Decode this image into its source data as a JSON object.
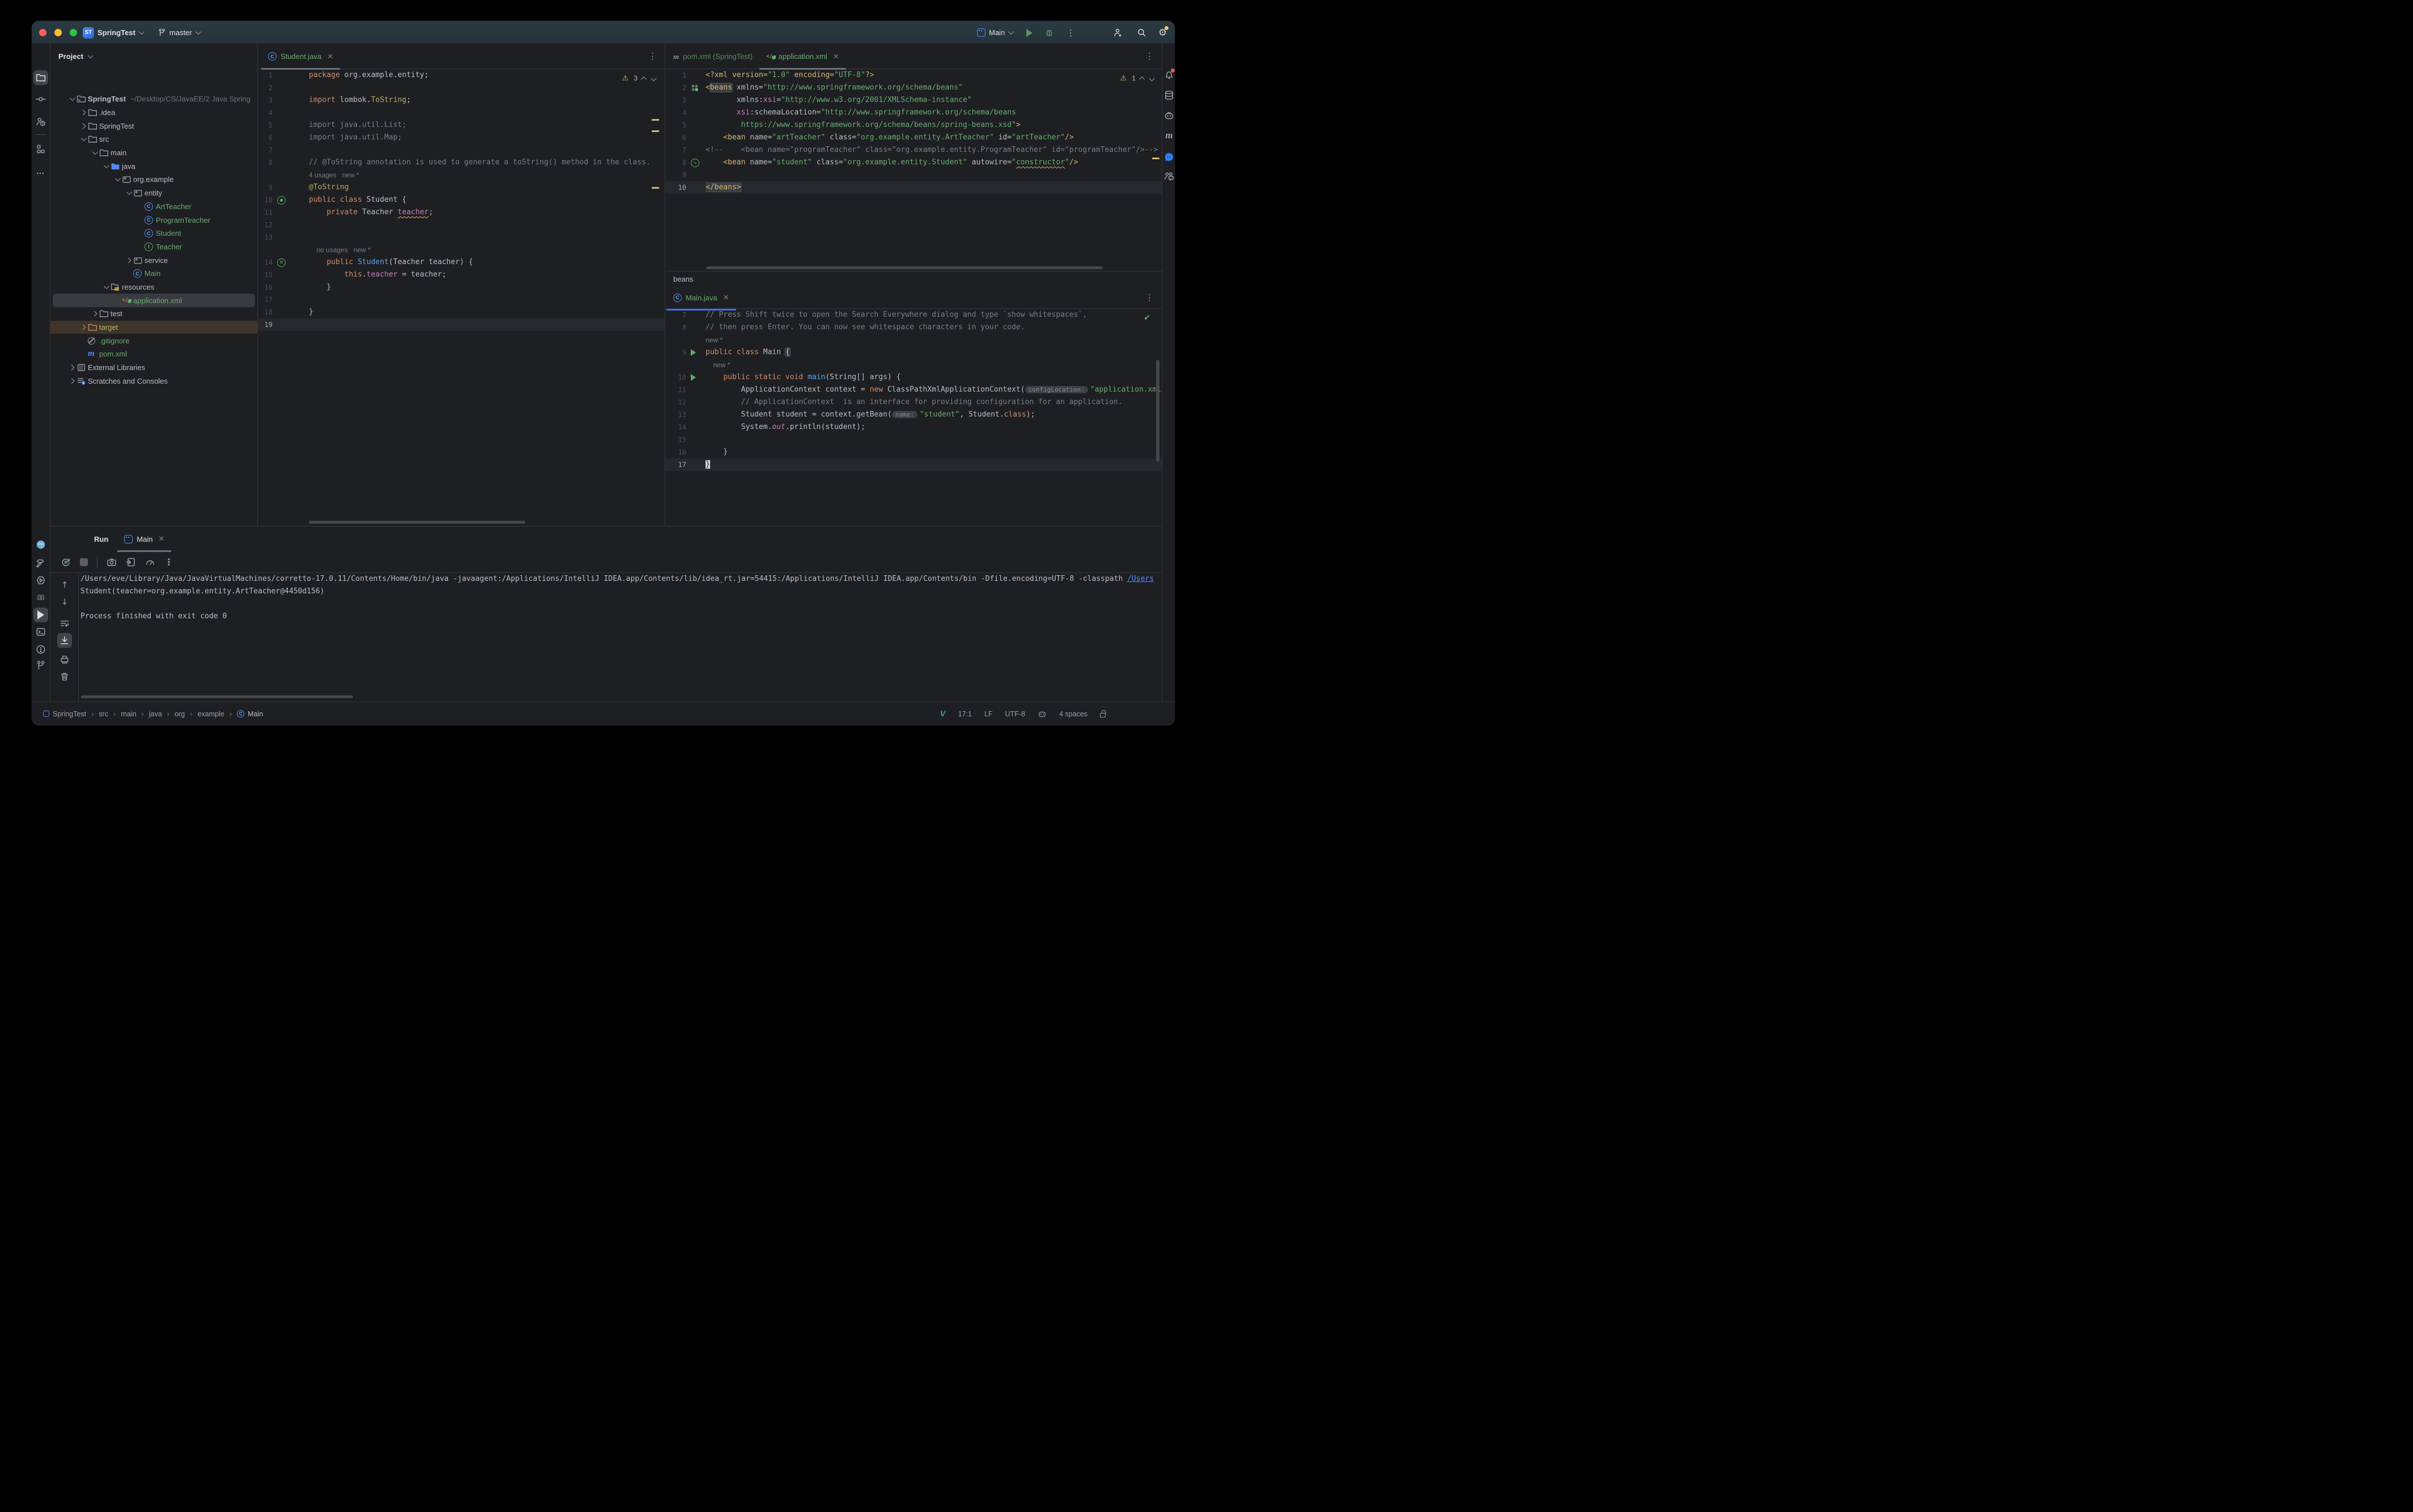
{
  "titlebar": {
    "project": "SpringTest",
    "project_badge": "ST",
    "branch": "master",
    "run_config": "Main"
  },
  "left_stripe": {
    "top": [
      {
        "icon": "project-folder",
        "active": true
      },
      {
        "icon": "commit"
      },
      {
        "icon": "pull-requests"
      },
      {
        "icon": "divider"
      },
      {
        "icon": "structure"
      },
      {
        "icon": "more"
      }
    ],
    "bottom": [
      {
        "icon": "plugin-mascot"
      },
      {
        "icon": "build-hammer"
      },
      {
        "icon": "services"
      },
      {
        "icon": "frames"
      },
      {
        "icon": "run",
        "active": true
      },
      {
        "icon": "terminal"
      },
      {
        "icon": "problems"
      },
      {
        "icon": "version-control"
      }
    ]
  },
  "right_stripe": [
    {
      "icon": "notifications",
      "badge": true
    },
    {
      "icon": "database"
    },
    {
      "icon": "copilot"
    },
    {
      "icon": "maven"
    },
    {
      "icon": "ai-assistant"
    },
    {
      "icon": "code-with-me"
    }
  ],
  "project_panel": {
    "header": "Project",
    "tree": [
      {
        "d": 0,
        "chev": "v",
        "icon": "module",
        "label": "SpringTest",
        "bold": true,
        "extra": "~/Desktop/CS/JavaEE/2 Java Spring"
      },
      {
        "d": 1,
        "chev": ">",
        "icon": "folder",
        "label": ".idea"
      },
      {
        "d": 1,
        "chev": ">",
        "icon": "folder",
        "label": "SpringTest"
      },
      {
        "d": 1,
        "chev": "v",
        "icon": "folder",
        "label": "src"
      },
      {
        "d": 2,
        "chev": "v",
        "icon": "folder",
        "label": "main"
      },
      {
        "d": 3,
        "chev": "v",
        "icon": "folder-blue",
        "label": "java"
      },
      {
        "d": 4,
        "chev": "v",
        "icon": "pkg",
        "label": "org.example"
      },
      {
        "d": 5,
        "chev": "v",
        "icon": "pkg",
        "label": "entity"
      },
      {
        "d": 6,
        "icon": "class",
        "label": "ArtTeacher",
        "color": "#6aab73"
      },
      {
        "d": 6,
        "icon": "class",
        "label": "ProgramTeacher",
        "color": "#6aab73"
      },
      {
        "d": 6,
        "icon": "class",
        "label": "Student",
        "color": "#6aab73"
      },
      {
        "d": 6,
        "icon": "iface",
        "label": "Teacher",
        "color": "#6aab73"
      },
      {
        "d": 5,
        "chev": ">",
        "icon": "pkg",
        "label": "service"
      },
      {
        "d": 5,
        "icon": "class",
        "label": "Main",
        "color": "#6aab73"
      },
      {
        "d": 3,
        "chev": "v",
        "icon": "folder-res",
        "label": "resources"
      },
      {
        "d": 4,
        "icon": "spring",
        "label": "application.xml",
        "color": "#6aab73",
        "selected": true
      },
      {
        "d": 2,
        "chev": ">",
        "icon": "folder",
        "label": "test"
      },
      {
        "d": 1,
        "chev": ">",
        "icon": "folder-target",
        "label": "target",
        "color": "#bdb76b",
        "highlight": true
      },
      {
        "d": 1,
        "icon": "ignore",
        "label": ".gitignore",
        "color": "#6aab73"
      },
      {
        "d": 1,
        "icon": "maven",
        "label": "pom.xml",
        "color": "#6aab73"
      },
      {
        "d": 0,
        "chev": ">",
        "icon": "lib",
        "label": "External Libraries"
      },
      {
        "d": 0,
        "chev": ">",
        "icon": "scratch",
        "label": "Scratches and Consoles"
      }
    ]
  },
  "editors": {
    "student": {
      "tab": "Student.java",
      "warnings": "3",
      "lines": [
        {
          "n": "1",
          "seg": [
            [
              "package ",
              "kw"
            ],
            [
              "org.example.entity;",
              "txt"
            ]
          ]
        },
        {
          "n": "2"
        },
        {
          "n": "3",
          "seg": [
            [
              "import ",
              "kw"
            ],
            [
              "lombok.",
              "txt"
            ],
            [
              "ToString",
              "ann"
            ],
            [
              ";",
              "txt"
            ]
          ]
        },
        {
          "n": "4"
        },
        {
          "n": "5",
          "seg": [
            [
              "import java.util.List;",
              "dim"
            ]
          ]
        },
        {
          "n": "6",
          "seg": [
            [
              "import java.util.Map;",
              "dim"
            ]
          ]
        },
        {
          "n": "7"
        },
        {
          "n": "8",
          "seg": [
            [
              "// @ToString annotation is used to generate a toString() method in the class.",
              "cmt"
            ]
          ]
        },
        {
          "inlay": "4 usages   new *"
        },
        {
          "n": "9",
          "seg": [
            [
              "@ToString",
              "ann"
            ]
          ]
        },
        {
          "n": "10",
          "g": "bean",
          "seg": [
            [
              "public class ",
              "kw"
            ],
            [
              "Student {",
              "txt"
            ]
          ]
        },
        {
          "n": "11",
          "seg": [
            [
              "    ",
              "txt"
            ],
            [
              "private ",
              "kw"
            ],
            [
              "Teacher ",
              "txt"
            ],
            [
              "teacher",
              "fld wavy"
            ],
            [
              ";",
              "txt"
            ]
          ]
        },
        {
          "n": "12"
        },
        {
          "n": "13"
        },
        {
          "inlay": "    no usages   new *"
        },
        {
          "n": "14",
          "g": "beanm",
          "seg": [
            [
              "    ",
              "txt"
            ],
            [
              "public ",
              "kw"
            ],
            [
              "Student",
              "mtd"
            ],
            [
              "(Teacher teacher) {",
              "txt"
            ]
          ]
        },
        {
          "n": "15",
          "seg": [
            [
              "        ",
              "txt"
            ],
            [
              "this",
              "kw"
            ],
            [
              ".",
              "txt"
            ],
            [
              "teacher",
              "fld"
            ],
            [
              " = teacher;",
              "txt"
            ]
          ]
        },
        {
          "n": "16",
          "seg": [
            [
              "    }",
              "txt"
            ]
          ]
        },
        {
          "n": "17"
        },
        {
          "n": "18",
          "seg": [
            [
              "}",
              "txt"
            ]
          ]
        },
        {
          "n": "19",
          "cur": true
        }
      ]
    },
    "xml": {
      "tab_pom": "pom.xml (SpringTest)",
      "tab_app": "application.xml",
      "warnings": "1",
      "breadcrumb": "beans",
      "lines": [
        {
          "n": "1",
          "seg": [
            [
              "<?xml ",
              "tag"
            ],
            [
              "version=",
              "tag"
            ],
            [
              "\"1.0\"",
              "str"
            ],
            [
              " encoding=",
              "tag"
            ],
            [
              "\"UTF-8\"",
              "str"
            ],
            [
              "?>",
              "tag"
            ]
          ]
        },
        {
          "n": "2",
          "g": "beangrid",
          "seg": [
            [
              "<",
              "tag"
            ],
            [
              "beans",
              "tag box"
            ],
            [
              " xmlns=",
              "attr"
            ],
            [
              "\"http://www.springframework.org/schema/beans\"",
              "str"
            ]
          ]
        },
        {
          "n": "3",
          "seg": [
            [
              "       xmlns:",
              "attr"
            ],
            [
              "xsi",
              "ns"
            ],
            [
              "=",
              "attr"
            ],
            [
              "\"http://www.w3.org/2001/XMLSchema-instance\"",
              "str"
            ]
          ]
        },
        {
          "n": "4",
          "seg": [
            [
              "       ",
              "txt"
            ],
            [
              "xsi",
              "ns"
            ],
            [
              ":schemaLocation=",
              "attr"
            ],
            [
              "\"http://www.springframework.org/schema/beans",
              "str"
            ]
          ]
        },
        {
          "n": "5",
          "seg": [
            [
              "        https://www.springframework.org/schema/beans/spring-beans.xsd\"",
              "str"
            ],
            [
              ">",
              "tag"
            ]
          ]
        },
        {
          "n": "6",
          "seg": [
            [
              "    <",
              "tag"
            ],
            [
              "bean ",
              "tag"
            ],
            [
              "name=",
              "attr"
            ],
            [
              "\"artTeacher\"",
              "str"
            ],
            [
              " class=",
              "attr"
            ],
            [
              "\"org.example.entity.ArtTeacher\"",
              "str"
            ],
            [
              " id=",
              "attr"
            ],
            [
              "\"artTeacher\"",
              "str"
            ],
            [
              "/>",
              "tag"
            ]
          ]
        },
        {
          "n": "7",
          "seg": [
            [
              "<!--    <bean name=\"programTeacher\" class=\"org.example.entity.ProgramTeacher\" id=\"programTeacher\"/>-->",
              "cmt"
            ]
          ]
        },
        {
          "n": "8",
          "g": "beanarrow",
          "seg": [
            [
              "    <",
              "tag"
            ],
            [
              "bean ",
              "tag"
            ],
            [
              "name=",
              "attr"
            ],
            [
              "\"student\"",
              "str"
            ],
            [
              " class=",
              "attr"
            ],
            [
              "\"org.example.entity.Student\"",
              "str"
            ],
            [
              " autowire=",
              "attr"
            ],
            [
              "\"",
              "str"
            ],
            [
              "constructor",
              "str wavy"
            ],
            [
              "\"",
              "str"
            ],
            [
              "/>",
              "tag"
            ]
          ]
        },
        {
          "n": "9"
        },
        {
          "n": "10",
          "cur": true,
          "seg": [
            [
              "</beans>",
              "tag box"
            ]
          ]
        }
      ]
    },
    "main": {
      "tab": "Main.java",
      "lines": [
        {
          "n": "7",
          "seg": [
            [
              "// Press Shift twice to open the Search Everywhere dialog and type `show whitespaces`,",
              "cmt"
            ]
          ]
        },
        {
          "n": "8",
          "seg": [
            [
              "// then press Enter. You can now see whitespace characters in your code.",
              "cmt"
            ]
          ]
        },
        {
          "inlay": "new *"
        },
        {
          "n": "9",
          "g": "play",
          "seg": [
            [
              "public class ",
              "kw"
            ],
            [
              "Main ",
              "txt"
            ],
            [
              "{",
              "txt box"
            ]
          ]
        },
        {
          "inlay": "    new *"
        },
        {
          "n": "10",
          "g": "play",
          "seg": [
            [
              "    ",
              "txt"
            ],
            [
              "public static void ",
              "kw"
            ],
            [
              "main",
              "mtd"
            ],
            [
              "(String[] args) {",
              "txt"
            ]
          ]
        },
        {
          "n": "11",
          "seg": [
            [
              "        ApplicationContext context = ",
              "txt"
            ],
            [
              "new ",
              "kw"
            ],
            [
              "ClassPathXmlApplicationContext(",
              "txt"
            ],
            [
              "configLocation:",
              "chip"
            ],
            [
              "\"application.xml\");",
              "str"
            ]
          ]
        },
        {
          "n": "12",
          "seg": [
            [
              "        // ApplicationContext  is an interface for providing configuration for an application.",
              "cmt"
            ]
          ]
        },
        {
          "n": "13",
          "seg": [
            [
              "        Student student = context.getBean(",
              "txt"
            ],
            [
              "name:",
              "chip"
            ],
            [
              "\"student\"",
              "str"
            ],
            [
              ", Student.",
              "txt"
            ],
            [
              "class",
              "kw"
            ],
            [
              ");",
              "txt"
            ]
          ]
        },
        {
          "n": "14",
          "seg": [
            [
              "        System.",
              "txt"
            ],
            [
              "out",
              "fld it"
            ],
            [
              ".println(student);",
              "txt"
            ]
          ]
        },
        {
          "n": "15"
        },
        {
          "n": "16",
          "seg": [
            [
              "    }",
              "txt"
            ]
          ]
        },
        {
          "n": "17",
          "cur": true,
          "seg": [
            [
              "}",
              "caret"
            ]
          ]
        }
      ]
    }
  },
  "run_panel": {
    "title": "Run",
    "tab": "Main",
    "toolbar": [
      "rerun",
      "stop",
      "thread-dump",
      "import-results",
      "profiler",
      "more"
    ],
    "left_toolbar": [
      {
        "icon": "arrow-up"
      },
      {
        "icon": "arrow-down"
      },
      {
        "icon": "soft-wrap"
      },
      {
        "icon": "scroll-to-end",
        "active": true
      },
      {
        "icon": "print"
      },
      {
        "icon": "clear"
      }
    ],
    "console": [
      {
        "seg": [
          [
            "/Users/eve/Library/Java/JavaVirtualMachines/corretto-17.0.11/Contents/Home/bin/java -javaagent:/Applications/IntelliJ IDEA.app/Contents/lib/idea_rt.jar=54415:/Applications/IntelliJ IDEA.app/Contents/bin -Dfile.encoding=UTF-8 -classpath ",
            "txt"
          ],
          [
            "/Users",
            "link"
          ]
        ]
      },
      {
        "seg": [
          [
            "Student(teacher=org.example.entity.ArtTeacher@4450d156)",
            "txt"
          ]
        ]
      },
      {},
      {
        "seg": [
          [
            "Process finished with exit code 0",
            "txt"
          ]
        ]
      }
    ]
  },
  "status_bar": {
    "breadcrumbs": [
      "SpringTest",
      "src",
      "main",
      "java",
      "org",
      "example",
      "Main"
    ],
    "right": {
      "vim": "V",
      "position": "17:1",
      "line_sep": "LF",
      "encoding": "UTF-8",
      "indent": "4 spaces"
    }
  }
}
